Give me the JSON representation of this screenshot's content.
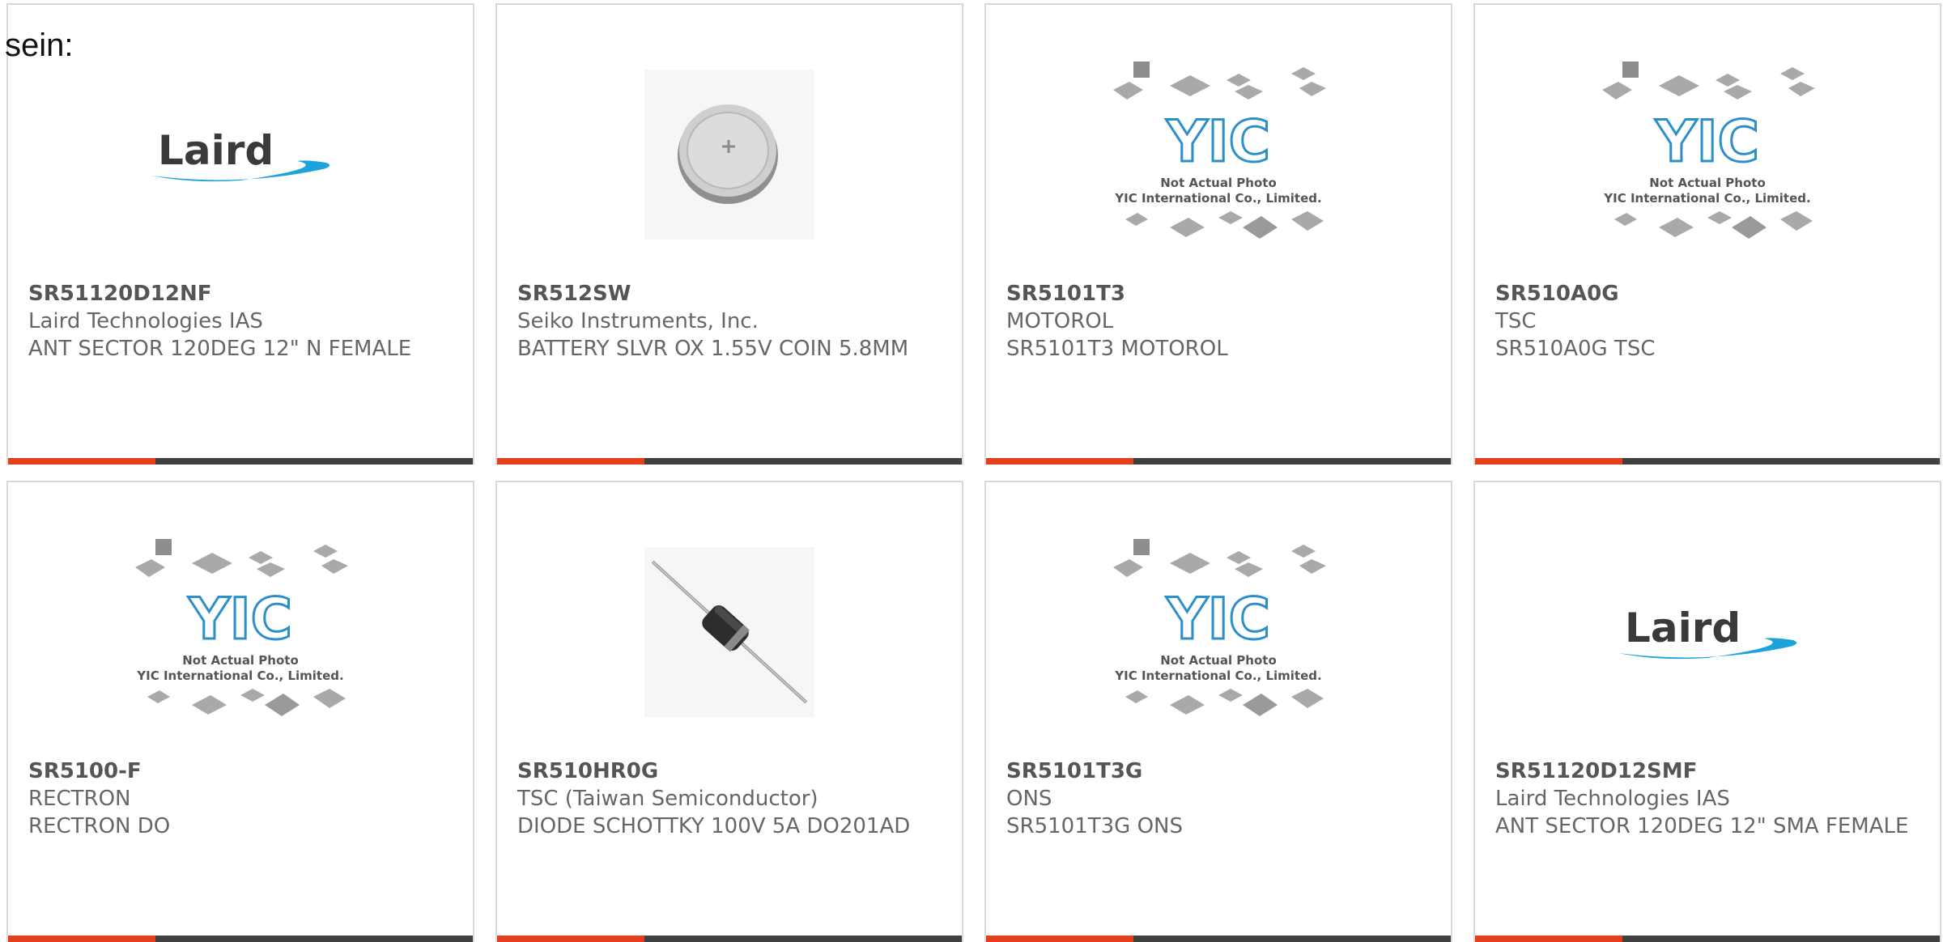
{
  "intro_text": "sein:",
  "accent_color": "#e2401c",
  "bar_color": "#404040",
  "image_labels": {
    "laird_logo": "Laird",
    "yic_logo": "YIC",
    "yic_line1": "Not Actual Photo",
    "yic_line2": "YIC International Co., Limited."
  },
  "products": [
    {
      "part_number": "SR51120D12NF",
      "manufacturer": "Laird Technologies IAS",
      "description": "ANT SECTOR 120DEG 12\" N FEMALE",
      "image": "laird-logo"
    },
    {
      "part_number": "SR512SW",
      "manufacturer": "Seiko Instruments, Inc.",
      "description": "BATTERY SLVR OX 1.55V COIN 5.8MM",
      "image": "coin-battery"
    },
    {
      "part_number": "SR5101T3",
      "manufacturer": "MOTOROL",
      "description": "SR5101T3 MOTOROL",
      "image": "yic-placeholder"
    },
    {
      "part_number": "SR510A0G",
      "manufacturer": "TSC",
      "description": "SR510A0G TSC",
      "image": "yic-placeholder"
    },
    {
      "part_number": "SR5100-F",
      "manufacturer": "RECTRON",
      "description": "RECTRON DO",
      "image": "yic-placeholder"
    },
    {
      "part_number": "SR510HR0G",
      "manufacturer": "TSC (Taiwan Semiconductor)",
      "description": "DIODE SCHOTTKY 100V 5A DO201AD",
      "image": "diode"
    },
    {
      "part_number": "SR5101T3G",
      "manufacturer": "ONS",
      "description": "SR5101T3G ONS",
      "image": "yic-placeholder"
    },
    {
      "part_number": "SR51120D12SMF",
      "manufacturer": "Laird Technologies IAS",
      "description": "ANT SECTOR 120DEG 12\" SMA FEMALE",
      "image": "laird-logo"
    }
  ]
}
